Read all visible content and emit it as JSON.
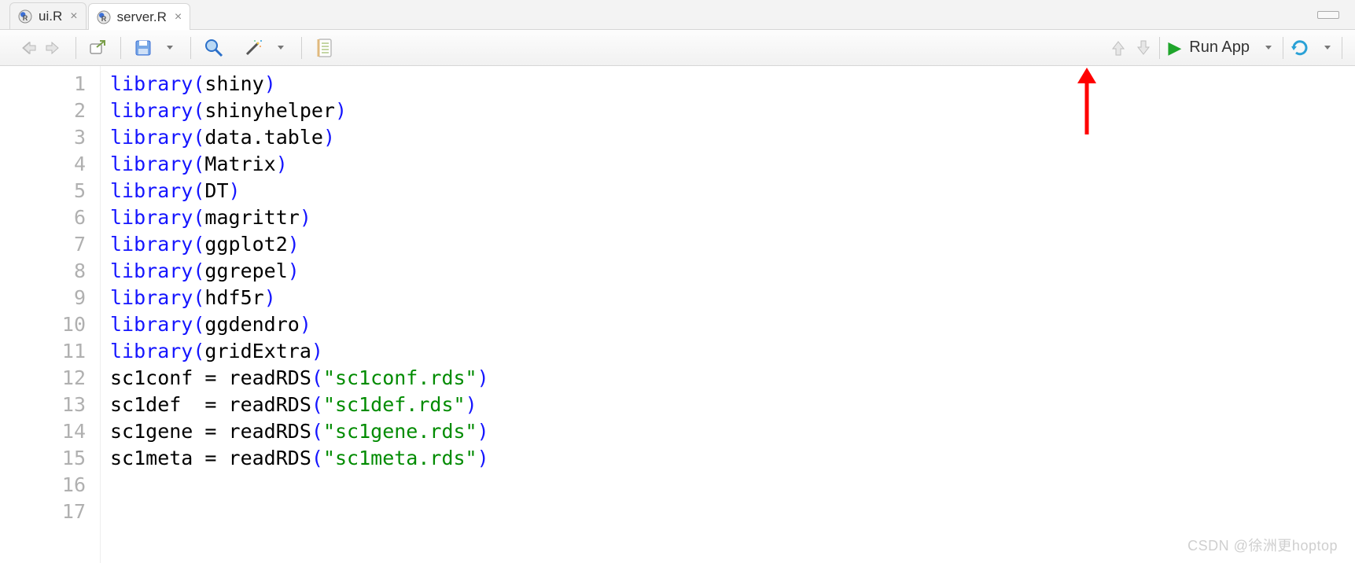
{
  "tabs": [
    {
      "label": "ui.R",
      "active": false
    },
    {
      "label": "server.R",
      "active": true
    }
  ],
  "toolbar": {
    "run_app_label": "Run App"
  },
  "code_lines": [
    {
      "n": "1",
      "tokens": [
        [
          "library",
          "fn"
        ],
        [
          "(",
          "paren"
        ],
        [
          "shiny",
          "id"
        ],
        [
          ")",
          "paren"
        ]
      ]
    },
    {
      "n": "2",
      "tokens": [
        [
          "library",
          "fn"
        ],
        [
          "(",
          "paren"
        ],
        [
          "shinyhelper",
          "id"
        ],
        [
          ")",
          "paren"
        ]
      ]
    },
    {
      "n": "3",
      "tokens": [
        [
          "library",
          "fn"
        ],
        [
          "(",
          "paren"
        ],
        [
          "data.table",
          "id"
        ],
        [
          ")",
          "paren"
        ]
      ]
    },
    {
      "n": "4",
      "tokens": [
        [
          "library",
          "fn"
        ],
        [
          "(",
          "paren"
        ],
        [
          "Matrix",
          "id"
        ],
        [
          ")",
          "paren"
        ]
      ]
    },
    {
      "n": "5",
      "tokens": [
        [
          "library",
          "fn"
        ],
        [
          "(",
          "paren"
        ],
        [
          "DT",
          "id"
        ],
        [
          ")",
          "paren"
        ]
      ]
    },
    {
      "n": "6",
      "tokens": [
        [
          "library",
          "fn"
        ],
        [
          "(",
          "paren"
        ],
        [
          "magrittr",
          "id"
        ],
        [
          ")",
          "paren"
        ]
      ]
    },
    {
      "n": "7",
      "tokens": [
        [
          "library",
          "fn"
        ],
        [
          "(",
          "paren"
        ],
        [
          "ggplot2",
          "id"
        ],
        [
          ")",
          "paren"
        ]
      ]
    },
    {
      "n": "8",
      "tokens": [
        [
          "library",
          "fn"
        ],
        [
          "(",
          "paren"
        ],
        [
          "ggrepel",
          "id"
        ],
        [
          ")",
          "paren"
        ]
      ]
    },
    {
      "n": "9",
      "tokens": [
        [
          "library",
          "fn"
        ],
        [
          "(",
          "paren"
        ],
        [
          "hdf5r",
          "id"
        ],
        [
          ")",
          "paren"
        ]
      ]
    },
    {
      "n": "10",
      "tokens": [
        [
          "library",
          "fn"
        ],
        [
          "(",
          "paren"
        ],
        [
          "ggdendro",
          "id"
        ],
        [
          ")",
          "paren"
        ]
      ]
    },
    {
      "n": "11",
      "tokens": [
        [
          "library",
          "fn"
        ],
        [
          "(",
          "paren"
        ],
        [
          "gridExtra",
          "id"
        ],
        [
          ")",
          "paren"
        ]
      ]
    },
    {
      "n": "12",
      "tokens": [
        [
          "sc1conf = readRDS",
          "id"
        ],
        [
          "(",
          "paren"
        ],
        [
          "\"sc1conf.rds\"",
          "str"
        ],
        [
          ")",
          "paren"
        ]
      ]
    },
    {
      "n": "13",
      "tokens": [
        [
          "sc1def  = readRDS",
          "id"
        ],
        [
          "(",
          "paren"
        ],
        [
          "\"sc1def.rds\"",
          "str"
        ],
        [
          ")",
          "paren"
        ]
      ]
    },
    {
      "n": "14",
      "tokens": [
        [
          "sc1gene = readRDS",
          "id"
        ],
        [
          "(",
          "paren"
        ],
        [
          "\"sc1gene.rds\"",
          "str"
        ],
        [
          ")",
          "paren"
        ]
      ]
    },
    {
      "n": "15",
      "tokens": [
        [
          "sc1meta = readRDS",
          "id"
        ],
        [
          "(",
          "paren"
        ],
        [
          "\"sc1meta.rds\"",
          "str"
        ],
        [
          ")",
          "paren"
        ]
      ]
    },
    {
      "n": "16",
      "tokens": []
    },
    {
      "n": "17",
      "tokens": []
    }
  ],
  "watermark": "CSDN @徐洲更hoptop"
}
